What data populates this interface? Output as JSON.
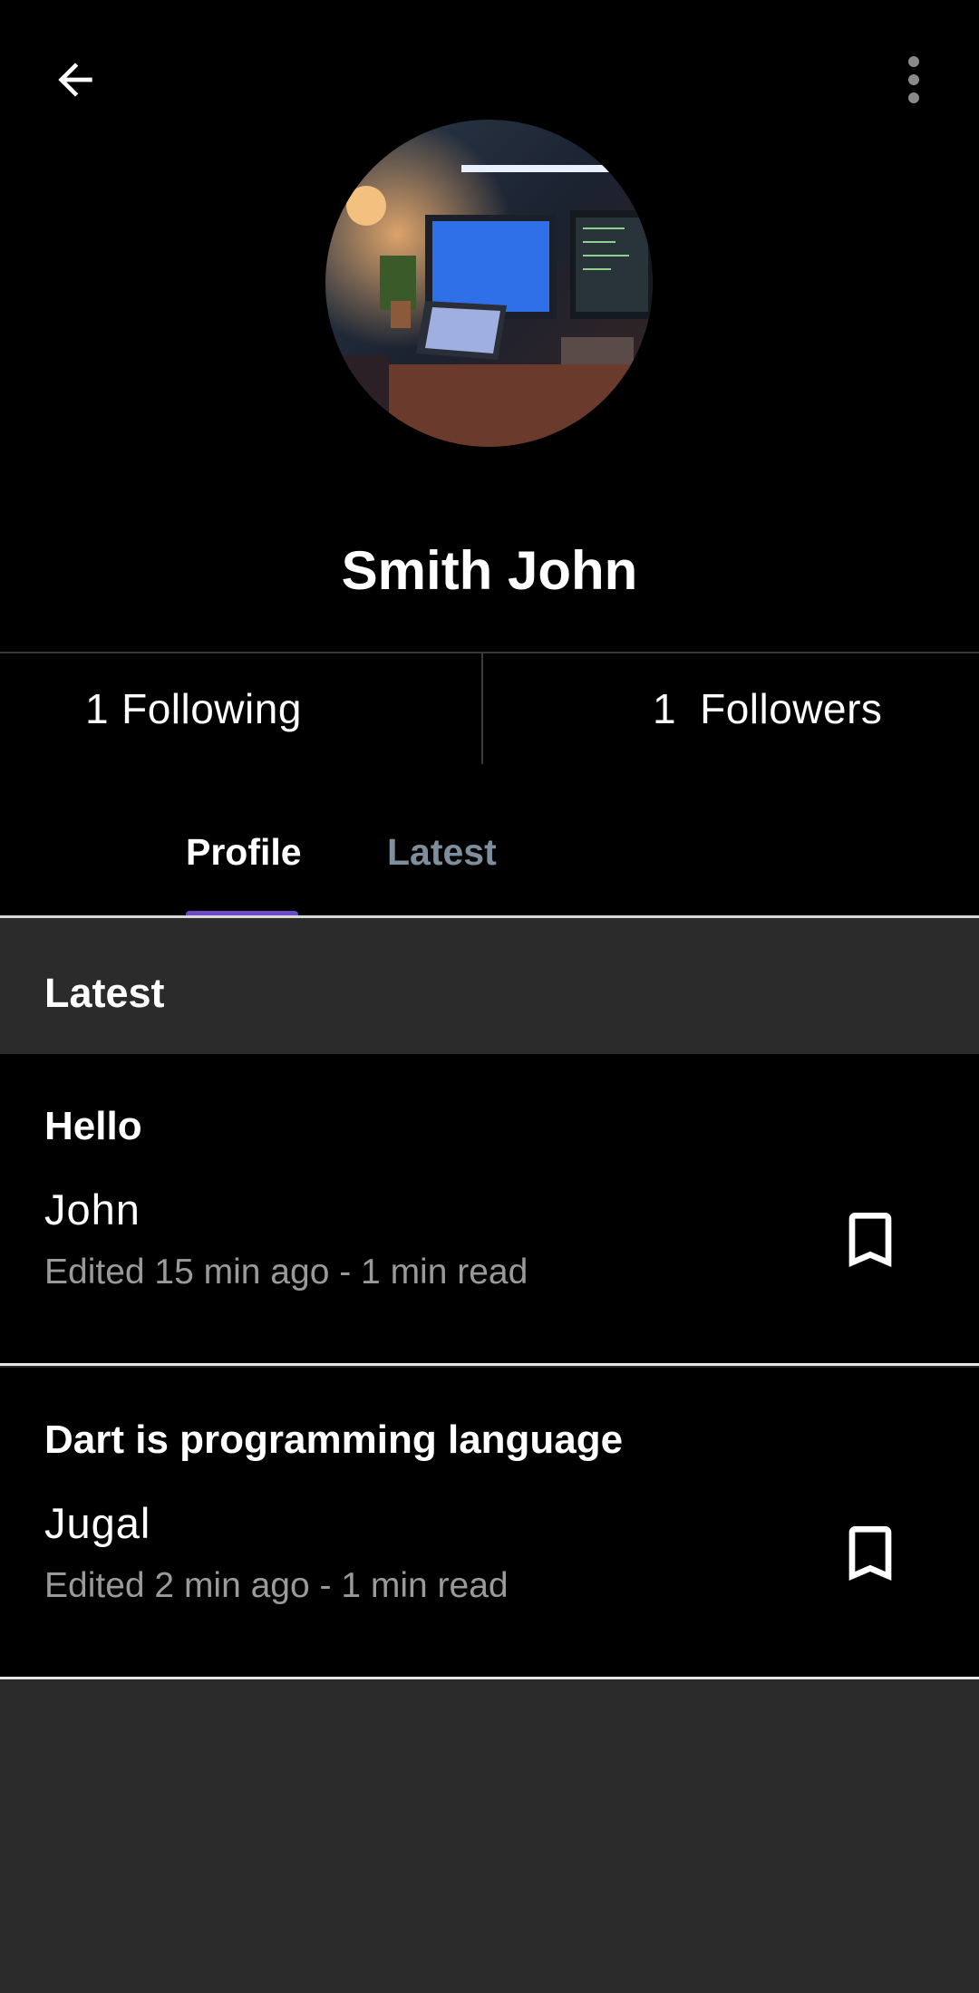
{
  "profile": {
    "name": "Smith John",
    "following_count": "1",
    "following_label": "Following",
    "followers_count": "1",
    "followers_label": "Followers"
  },
  "tabs": [
    {
      "label": "Profile",
      "active": true
    },
    {
      "label": "Latest",
      "active": false
    }
  ],
  "section": {
    "title": "Latest"
  },
  "posts": [
    {
      "title": "Hello",
      "author": "John",
      "meta": "Edited 15 min ago - 1 min read"
    },
    {
      "title": "Dart is programming language",
      "author": "Jugal",
      "meta": "Edited 2 min ago - 1 min read"
    }
  ],
  "icons": {
    "back": "arrow-back-icon",
    "more": "more-vert-icon",
    "bookmark": "bookmark-outline-icon"
  },
  "colors": {
    "background": "#000000",
    "surface": "#2a2a2a",
    "tab_indicator": "#6a4bc4",
    "tab_inactive": "#7f8e9c",
    "meta_text": "#9a9a9a"
  }
}
